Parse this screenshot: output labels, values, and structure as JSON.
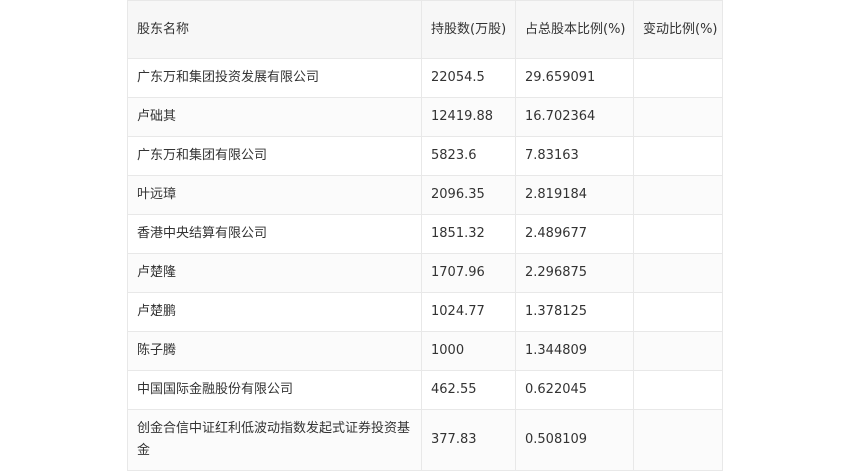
{
  "table": {
    "headers": [
      "股东名称",
      "持股数(万股)",
      "占总股本比例(%)",
      "变动比例(%)"
    ],
    "rows": [
      [
        "广东万和集团投资发展有限公司",
        "22054.5",
        "29.659091",
        ""
      ],
      [
        "卢础其",
        "12419.88",
        "16.702364",
        ""
      ],
      [
        "广东万和集团有限公司",
        "5823.6",
        "7.83163",
        ""
      ],
      [
        "叶远璋",
        "2096.35",
        "2.819184",
        ""
      ],
      [
        "香港中央结算有限公司",
        "1851.32",
        "2.489677",
        ""
      ],
      [
        "卢楚隆",
        "1707.96",
        "2.296875",
        ""
      ],
      [
        "卢楚鹏",
        "1024.77",
        "1.378125",
        ""
      ],
      [
        "陈子腾",
        "1000",
        "1.344809",
        ""
      ],
      [
        "中国国际金融股份有限公司",
        "462.55",
        "0.622045",
        ""
      ],
      [
        "创金合信中证红利低波动指数发起式证券投资基金",
        "377.83",
        "0.508109",
        ""
      ]
    ]
  }
}
